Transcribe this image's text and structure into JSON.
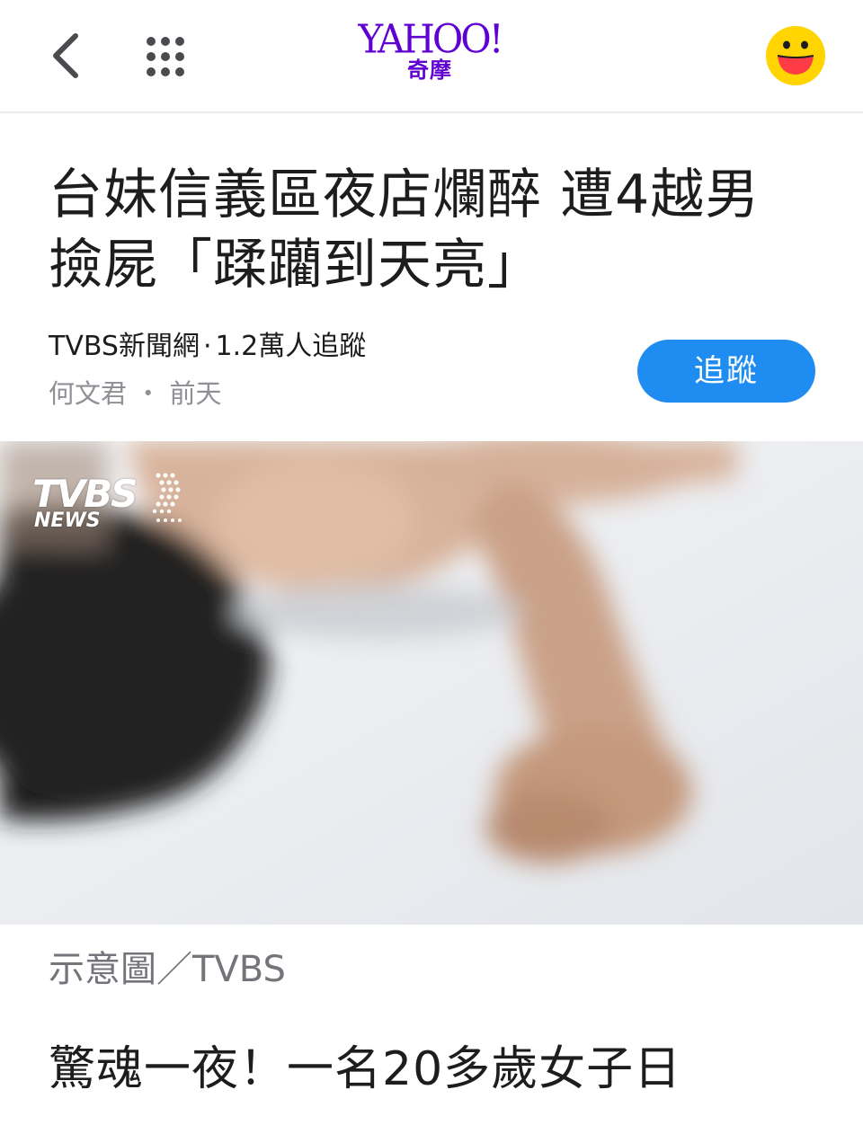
{
  "nav": {
    "back_icon": "chevron-left-icon",
    "menu_icon": "grid-dots-icon",
    "logo_word": "YAHOO!",
    "logo_sub": "奇摩",
    "profile_icon": "smiley-face-icon",
    "brand_color": "#5f01d1"
  },
  "article": {
    "headline_line1": "台妹信義區夜店爛醉 遭4越男",
    "headline_line2": "撿屍「蹂躪到天亮」",
    "provider": "TVBS新聞網",
    "followers": "1.2萬人追蹤",
    "author": "何文君",
    "time": "前天",
    "follow_label": "追蹤",
    "follow_color": "#1e8cf0",
    "image_watermark_main": "TVBS",
    "image_watermark_sub": "NEWS",
    "image_caption": "示意圖／TVBS",
    "body_first_line": "驚魂一夜！一名20多歲女子日"
  }
}
